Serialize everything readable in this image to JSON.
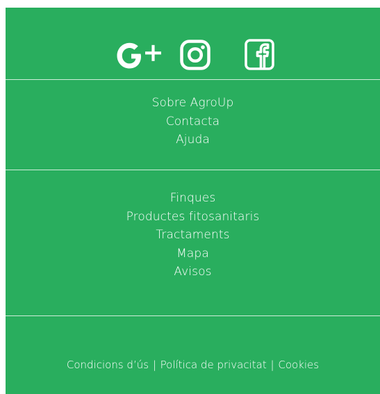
{
  "footer": {
    "background_color": "#29ae5e",
    "text_color": "#ffffff",
    "social": [
      {
        "name": "google-plus",
        "icon": "google-plus-icon"
      },
      {
        "name": "instagram",
        "icon": "instagram-icon"
      },
      {
        "name": "facebook",
        "icon": "facebook-icon"
      }
    ],
    "about_links": [
      {
        "label": "Sobre AgroUp"
      },
      {
        "label": "Contacta"
      },
      {
        "label": "Ajuda"
      }
    ],
    "app_links": [
      {
        "label": "Finques"
      },
      {
        "label": "Productes fitosanitaris"
      },
      {
        "label": "Tractaments"
      },
      {
        "label": "Mapa"
      },
      {
        "label": "Avisos"
      }
    ],
    "legal": {
      "terms": "Condicions d’ús",
      "privacy": "Política de privacitat",
      "cookies": "Cookies",
      "separator": "|"
    }
  }
}
